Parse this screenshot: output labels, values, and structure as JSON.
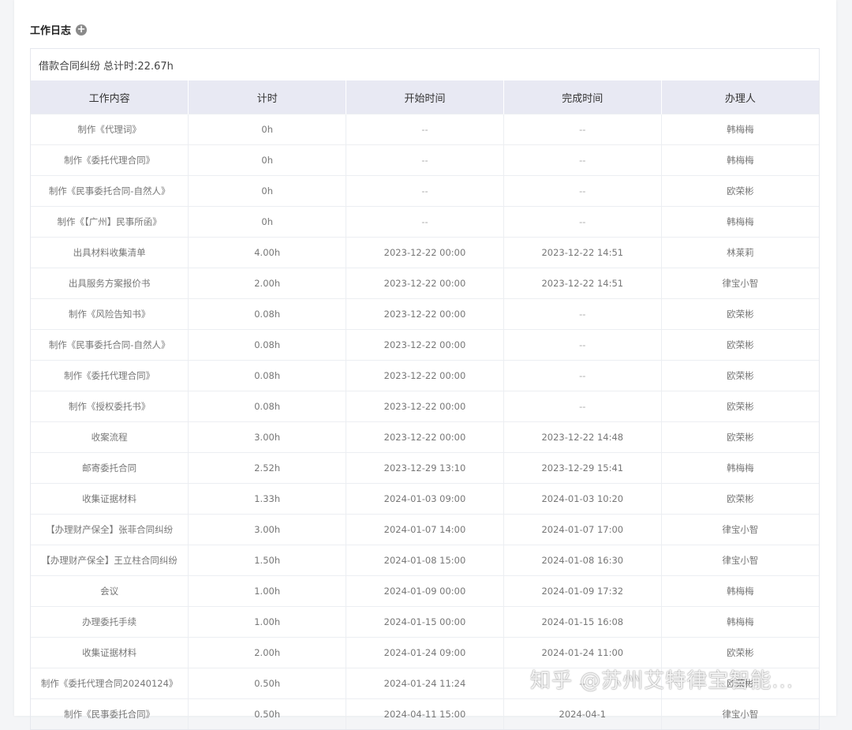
{
  "section": {
    "title": "工作日志",
    "add_icon": "plus-circle-icon",
    "add_icon_glyph": "+"
  },
  "case": {
    "name": "借款合同纠纷",
    "total": "总计时:22.67h"
  },
  "table": {
    "headers": [
      "工作内容",
      "计时",
      "开始时间",
      "完成时间",
      "办理人"
    ],
    "rows": [
      [
        "制作《代理词》",
        "0h",
        "--",
        "--",
        "韩梅梅"
      ],
      [
        "制作《委托代理合同》",
        "0h",
        "--",
        "--",
        "韩梅梅"
      ],
      [
        "制作《民事委托合同-自然人》",
        "0h",
        "--",
        "--",
        "欧荣彬"
      ],
      [
        "制作《【广州】民事所函》",
        "0h",
        "--",
        "--",
        "韩梅梅"
      ],
      [
        "出具材料收集清单",
        "4.00h",
        "2023-12-22 00:00",
        "2023-12-22 14:51",
        "林莱莉"
      ],
      [
        "出具服务方案报价书",
        "2.00h",
        "2023-12-22 00:00",
        "2023-12-22 14:51",
        "律宝小智"
      ],
      [
        "制作《风险告知书》",
        "0.08h",
        "2023-12-22 00:00",
        "--",
        "欧荣彬"
      ],
      [
        "制作《民事委托合同-自然人》",
        "0.08h",
        "2023-12-22 00:00",
        "--",
        "欧荣彬"
      ],
      [
        "制作《委托代理合同》",
        "0.08h",
        "2023-12-22 00:00",
        "--",
        "欧荣彬"
      ],
      [
        "制作《授权委托书》",
        "0.08h",
        "2023-12-22 00:00",
        "--",
        "欧荣彬"
      ],
      [
        "收案流程",
        "3.00h",
        "2023-12-22 00:00",
        "2023-12-22 14:48",
        "欧荣彬"
      ],
      [
        "邮寄委托合同",
        "2.52h",
        "2023-12-29 13:10",
        "2023-12-29 15:41",
        "韩梅梅"
      ],
      [
        "收集证据材料",
        "1.33h",
        "2024-01-03 09:00",
        "2024-01-03 10:20",
        "欧荣彬"
      ],
      [
        "【办理财产保全】张菲合同纠纷",
        "3.00h",
        "2024-01-07 14:00",
        "2024-01-07 17:00",
        "律宝小智"
      ],
      [
        "【办理财产保全】王立柱合同纠纷",
        "1.50h",
        "2024-01-08 15:00",
        "2024-01-08 16:30",
        "律宝小智"
      ],
      [
        "会议",
        "1.00h",
        "2024-01-09 00:00",
        "2024-01-09 17:32",
        "韩梅梅"
      ],
      [
        "办理委托手续",
        "1.00h",
        "2024-01-15 00:00",
        "2024-01-15 16:08",
        "韩梅梅"
      ],
      [
        "收集证据材料",
        "2.00h",
        "2024-01-24 09:00",
        "2024-01-24 11:00",
        "欧荣彬"
      ],
      [
        "制作《委托代理合同20240124》",
        "0.50h",
        "2024-01-24 11:24",
        "--",
        "欧荣彬"
      ],
      [
        "制作《民事委托合同》",
        "0.50h",
        "2024-04-11 15:00",
        "2024-04-1",
        "律宝小智"
      ]
    ]
  },
  "watermark": "知乎 @苏州艾特律宝智能..."
}
